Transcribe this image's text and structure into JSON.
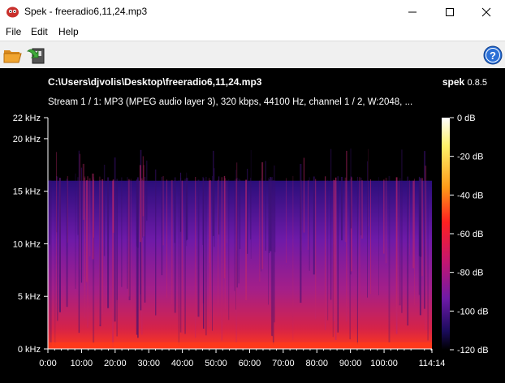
{
  "window": {
    "title": "Spek - freeradio6,11,24.mp3"
  },
  "menu": {
    "items": [
      "File",
      "Edit",
      "Help"
    ]
  },
  "toolbar": {
    "open_icon": "folder-open-icon",
    "save_icon": "save-image-icon",
    "help_icon": "help-icon"
  },
  "header": {
    "file_path": "C:\\Users\\djvolis\\Desktop\\freeradio6,11,24.mp3",
    "brand_name": "spek",
    "brand_version": "0.8.5",
    "stream_info": "Stream 1 / 1: MP3 (MPEG audio layer 3), 320 kbps, 44100 Hz, channel 1 / 2, W:2048, ..."
  },
  "spectrogram": {
    "freq_ticks": [
      "22 kHz",
      "20 kHz",
      "15 kHz",
      "10 kHz",
      "5 kHz",
      "0 kHz"
    ],
    "freq_values": [
      22,
      20,
      15,
      10,
      5,
      0
    ],
    "freq_max": 22,
    "cutoff_khz": 16,
    "time_ticks": [
      "0:00",
      "10:00",
      "20:00",
      "30:00",
      "40:00",
      "50:00",
      "60:00",
      "70:00",
      "80:00",
      "90:00",
      "100:00",
      "114:14"
    ],
    "time_values_min": [
      0,
      10,
      20,
      30,
      40,
      50,
      60,
      70,
      80,
      90,
      100,
      114.2333
    ],
    "duration_min": 114.2333,
    "db_ticks": [
      "0 dB",
      "-20 dB",
      "-40 dB",
      "-60 dB",
      "-80 dB",
      "-100 dB",
      "-120 dB"
    ],
    "db_values": [
      0,
      -20,
      -40,
      -60,
      -80,
      -100,
      -120
    ],
    "db_min": -120,
    "colors": {
      "background": "#000000",
      "low": "#1a0b5c",
      "mid": "#9b1fa8",
      "high": "#ff2a1c",
      "peak": "#ffffff"
    }
  }
}
